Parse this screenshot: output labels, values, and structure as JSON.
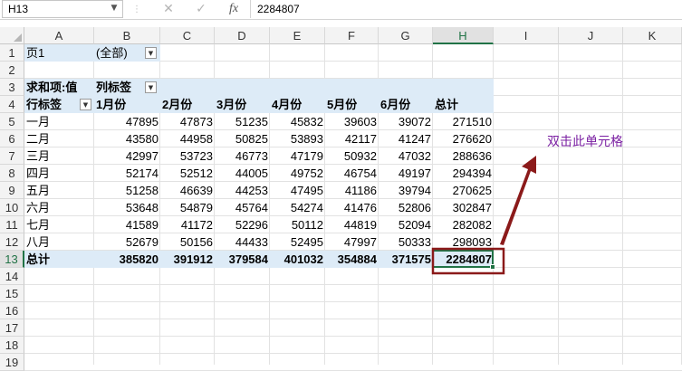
{
  "formula_bar": {
    "name_box": "H13",
    "cancel_icon": "✕",
    "enter_icon": "✓",
    "fx_label": "fx",
    "content": "2284807"
  },
  "columns": [
    "A",
    "B",
    "C",
    "D",
    "E",
    "F",
    "G",
    "H",
    "I",
    "J",
    "K"
  ],
  "rows": [
    "1",
    "2",
    "3",
    "4",
    "5",
    "6",
    "7",
    "8",
    "9",
    "10",
    "11",
    "12",
    "13",
    "14",
    "15",
    "16",
    "17",
    "18",
    "19"
  ],
  "pivot": {
    "page_label": "页1",
    "page_value": "(全部)",
    "sum_label": "求和项:值",
    "col_label": "列标签",
    "row_label": "行标签",
    "headers": [
      "1月份",
      "2月份",
      "3月份",
      "4月份",
      "5月份",
      "6月份",
      "总计"
    ],
    "data_rows": [
      {
        "label": "一月",
        "values": [
          "47895",
          "47873",
          "51235",
          "45832",
          "39603",
          "39072",
          "271510"
        ]
      },
      {
        "label": "二月",
        "values": [
          "43580",
          "44958",
          "50825",
          "53893",
          "42117",
          "41247",
          "276620"
        ]
      },
      {
        "label": "三月",
        "values": [
          "42997",
          "53723",
          "46773",
          "47179",
          "50932",
          "47032",
          "288636"
        ]
      },
      {
        "label": "四月",
        "values": [
          "52174",
          "52512",
          "44005",
          "49752",
          "46754",
          "49197",
          "294394"
        ]
      },
      {
        "label": "五月",
        "values": [
          "51258",
          "46639",
          "44253",
          "47495",
          "41186",
          "39794",
          "270625"
        ]
      },
      {
        "label": "六月",
        "values": [
          "53648",
          "54879",
          "45764",
          "54274",
          "41476",
          "52806",
          "302847"
        ]
      },
      {
        "label": "七月",
        "values": [
          "41589",
          "41172",
          "52296",
          "50112",
          "44819",
          "52094",
          "282082"
        ]
      },
      {
        "label": "八月",
        "values": [
          "52679",
          "50156",
          "44433",
          "52495",
          "47997",
          "50333",
          "298093"
        ]
      }
    ],
    "total_row": {
      "label": "总计",
      "values": [
        "385820",
        "391912",
        "379584",
        "401032",
        "354884",
        "371575",
        "2284807"
      ]
    }
  },
  "annotation": {
    "text": "双击此单元格",
    "color": "#8B1A1A",
    "text_color": "#7A1FA2"
  },
  "colors": {
    "pivot_header_bg": "#DDEBF7",
    "selection_green": "#217346",
    "highlight_box": "#8B1A1A"
  }
}
